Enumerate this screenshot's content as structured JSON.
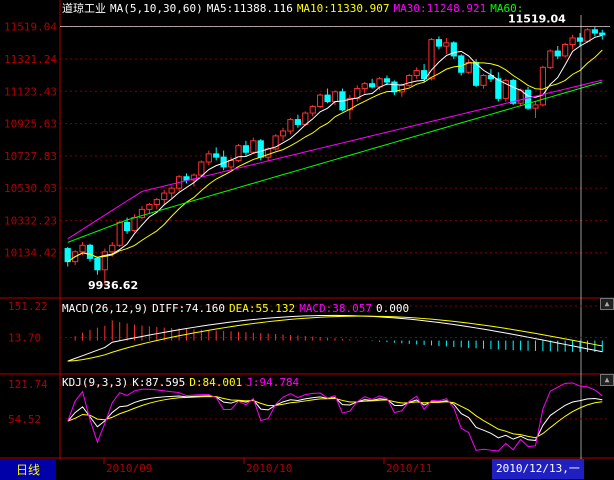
{
  "main_header": {
    "title": "道琼工业",
    "ma_label": "MA(5,10,30,60)",
    "ma5": "MA5:11388.116",
    "ma10": "MA10:11330.907",
    "ma30": "MA30:11248.921",
    "ma60": "MA60:"
  },
  "macd_header": {
    "label": "MACD(26,12,9)",
    "diff": "DIFF:74.160",
    "dea": "DEA:55.132",
    "macd": "MACD:38.057",
    "zero": "0.000"
  },
  "kdj_header": {
    "label": "KDJ(9,3,3)",
    "k": "K:87.595",
    "d": "D:84.001",
    "j": "J:94.784"
  },
  "price_axis": [
    "11519.04",
    "11321.24",
    "11123.43",
    "10925.63",
    "10727.83",
    "10530.03",
    "10332.23",
    "10134.42"
  ],
  "macd_axis": [
    "151.22",
    "13.70"
  ],
  "kdj_axis": [
    "121.74",
    "54.52"
  ],
  "annotations": {
    "high": "11519.04",
    "low": "9936.62"
  },
  "dates": [
    "2010/09",
    "2010/10",
    "2010/11"
  ],
  "cursor_date": "2010/12/13,一",
  "period_tab": "日线",
  "colors": {
    "up": "#ff3030",
    "down": "#00ffff",
    "ma5": "#ffffff",
    "ma10": "#ffff00",
    "ma30": "#ff00ff",
    "ma60": "#00ff00",
    "grid": "#800000",
    "axis": "#b00000"
  },
  "chart_data": {
    "type": "candlestick",
    "price_range": [
      9936.62,
      11519.04
    ],
    "candles": [
      [
        10160,
        10170,
        10050,
        10080
      ],
      [
        10080,
        10150,
        10060,
        10140
      ],
      [
        10140,
        10200,
        10120,
        10180
      ],
      [
        10180,
        10190,
        10080,
        10100
      ],
      [
        10100,
        10110,
        10000,
        10030
      ],
      [
        10030,
        10160,
        9936.62,
        10140
      ],
      [
        10140,
        10200,
        10110,
        10180
      ],
      [
        10180,
        10330,
        10170,
        10320
      ],
      [
        10320,
        10350,
        10250,
        10270
      ],
      [
        10270,
        10370,
        10260,
        10350
      ],
      [
        10350,
        10420,
        10340,
        10400
      ],
      [
        10400,
        10440,
        10370,
        10430
      ],
      [
        10430,
        10470,
        10400,
        10460
      ],
      [
        10460,
        10520,
        10430,
        10500
      ],
      [
        10500,
        10540,
        10470,
        10530
      ],
      [
        10530,
        10610,
        10510,
        10600
      ],
      [
        10600,
        10620,
        10560,
        10580
      ],
      [
        10580,
        10620,
        10540,
        10610
      ],
      [
        10610,
        10700,
        10600,
        10690
      ],
      [
        10690,
        10760,
        10670,
        10740
      ],
      [
        10740,
        10780,
        10700,
        10720
      ],
      [
        10720,
        10760,
        10640,
        10660
      ],
      [
        10660,
        10720,
        10640,
        10700
      ],
      [
        10700,
        10800,
        10690,
        10790
      ],
      [
        10790,
        10820,
        10730,
        10750
      ],
      [
        10750,
        10840,
        10740,
        10820
      ],
      [
        10820,
        10830,
        10700,
        10720
      ],
      [
        10720,
        10780,
        10700,
        10770
      ],
      [
        10770,
        10860,
        10760,
        10850
      ],
      [
        10850,
        10900,
        10820,
        10880
      ],
      [
        10880,
        10960,
        10860,
        10950
      ],
      [
        10950,
        10980,
        10900,
        10920
      ],
      [
        10920,
        11000,
        10910,
        10990
      ],
      [
        10990,
        11040,
        10970,
        11030
      ],
      [
        11030,
        11110,
        11020,
        11100
      ],
      [
        11100,
        11140,
        11050,
        11060
      ],
      [
        11060,
        11130,
        11040,
        11120
      ],
      [
        11120,
        11140,
        11000,
        11010
      ],
      [
        11010,
        11100,
        10950,
        11080
      ],
      [
        11080,
        11160,
        11060,
        11140
      ],
      [
        11140,
        11180,
        11110,
        11170
      ],
      [
        11170,
        11200,
        11140,
        11150
      ],
      [
        11150,
        11210,
        11130,
        11200
      ],
      [
        11200,
        11220,
        11160,
        11180
      ],
      [
        11180,
        11190,
        11100,
        11120
      ],
      [
        11120,
        11170,
        11090,
        11160
      ],
      [
        11160,
        11230,
        11150,
        11220
      ],
      [
        11220,
        11270,
        11200,
        11250
      ],
      [
        11250,
        11290,
        11180,
        11200
      ],
      [
        11200,
        11450,
        11190,
        11440
      ],
      [
        11440,
        11460,
        11380,
        11400
      ],
      [
        11400,
        11450,
        11350,
        11420
      ],
      [
        11420,
        11430,
        11320,
        11340
      ],
      [
        11340,
        11350,
        11220,
        11240
      ],
      [
        11240,
        11320,
        11230,
        11300
      ],
      [
        11300,
        11320,
        11150,
        11160
      ],
      [
        11160,
        11230,
        11140,
        11220
      ],
      [
        11220,
        11260,
        11180,
        11200
      ],
      [
        11200,
        11240,
        11060,
        11080
      ],
      [
        11080,
        11200,
        11060,
        11190
      ],
      [
        11190,
        11200,
        11040,
        11050
      ],
      [
        11050,
        11140,
        11030,
        11130
      ],
      [
        11130,
        11150,
        11010,
        11020
      ],
      [
        11020,
        11060,
        10960,
        11040
      ],
      [
        11040,
        11280,
        11030,
        11270
      ],
      [
        11270,
        11380,
        11260,
        11370
      ],
      [
        11370,
        11400,
        11320,
        11340
      ],
      [
        11340,
        11420,
        11330,
        11410
      ],
      [
        11410,
        11470,
        11380,
        11450
      ],
      [
        11450,
        11480,
        11400,
        11430
      ],
      [
        11430,
        11510,
        11420,
        11500
      ],
      [
        11500,
        11519.04,
        11460,
        11480
      ],
      [
        11480,
        11500,
        11440,
        11470
      ]
    ],
    "macd_range": [
      -120,
      151.22
    ],
    "kdj_range": [
      0,
      121.74
    ]
  }
}
